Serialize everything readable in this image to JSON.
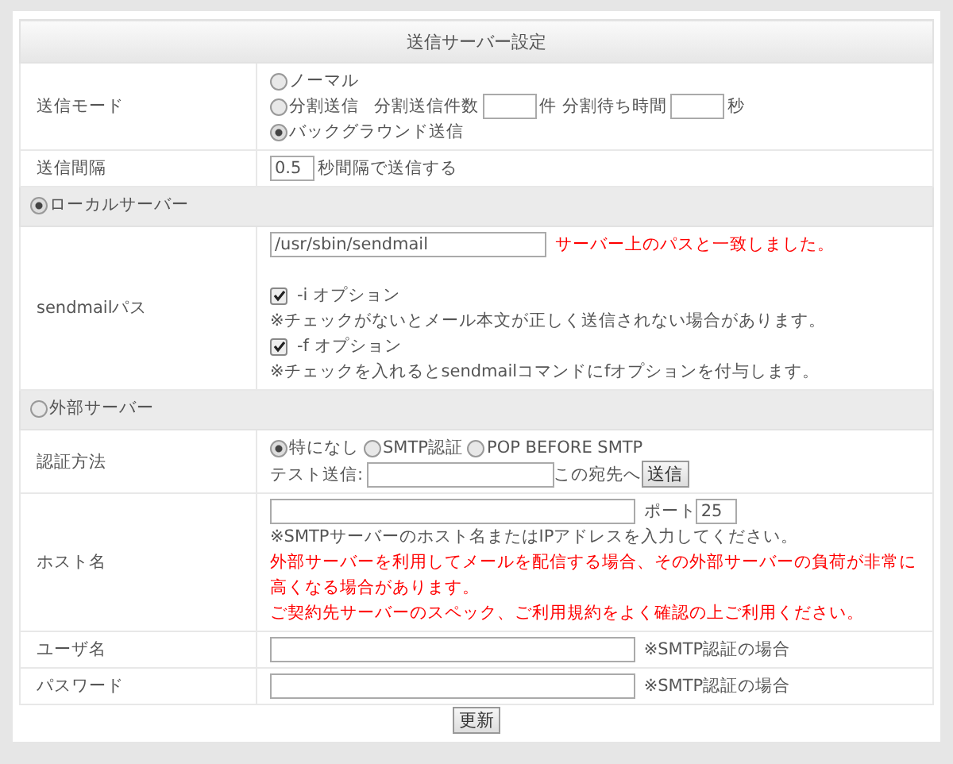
{
  "title": "送信サーバー設定",
  "send_mode": {
    "label": "送信モード",
    "options": [
      {
        "label": "ノーマル",
        "selected": false
      },
      {
        "label": "分割送信",
        "selected": false
      },
      {
        "label": "バックグラウンド送信",
        "selected": true
      }
    ],
    "split_count_label": "分割送信件数",
    "split_count_unit": "件",
    "split_wait_label": "分割待ち時間",
    "split_wait_unit": "秒"
  },
  "interval": {
    "label": "送信間隔",
    "value": "0.5",
    "suffix": "秒間隔で送信する"
  },
  "local_server": {
    "label": "ローカルサーバー",
    "selected": true
  },
  "sendmail": {
    "label": "sendmailパス",
    "value": "/usr/sbin/sendmail",
    "status": "サーバー上のパスと一致しました。",
    "options": [
      {
        "label": "-i オプション",
        "checked": true,
        "note": "※チェックがないとメール本文が正しく送信されない場合があります。"
      },
      {
        "label": "-f オプション",
        "checked": true,
        "note": "※チェックを入れるとsendmailコマンドにfオプションを付与します。"
      }
    ]
  },
  "external_server": {
    "label": "外部サーバー",
    "selected": false
  },
  "auth": {
    "label": "認証方法",
    "options": [
      {
        "label": "特になし",
        "selected": true
      },
      {
        "label": "SMTP認証",
        "selected": false
      },
      {
        "label": "POP BEFORE SMTP",
        "selected": false
      }
    ],
    "test_label": "テスト送信:",
    "test_suffix": "この宛先へ",
    "test_button": "送信"
  },
  "host": {
    "label": "ホスト名",
    "port_label": "ポート",
    "port_value": "25",
    "note": "※SMTPサーバーのホスト名またはIPアドレスを入力してください。",
    "warnings": [
      "外部サーバーを利用してメールを配信する場合、その外部サーバーの負荷が非常に高くなる場合があります。",
      "ご契約先サーバーのスペック、ご利用規約をよく確認の上ご利用ください。"
    ]
  },
  "user": {
    "label": "ユーザ名",
    "note": "※SMTP認証の場合"
  },
  "password": {
    "label": "パスワード",
    "note": "※SMTP認証の場合"
  },
  "submit": "更新"
}
